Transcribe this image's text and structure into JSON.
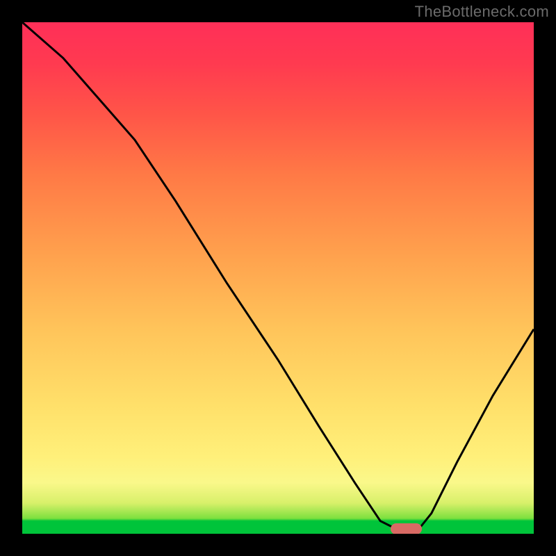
{
  "watermark": "TheBottleneck.com",
  "colors": {
    "background": "#000000",
    "curve": "#000000",
    "marker": "#d86a64",
    "gradient_top": "#ff2f58",
    "gradient_bottom": "#00c43a"
  },
  "chart_data": {
    "type": "line",
    "title": "",
    "xlabel": "",
    "ylabel": "",
    "xlim": [
      0,
      100
    ],
    "ylim": [
      0,
      100
    ],
    "grid": false,
    "legend": false,
    "series": [
      {
        "name": "bottleneck-curve",
        "x": [
          0,
          8,
          15,
          22,
          30,
          40,
          50,
          58,
          65,
          70,
          73,
          76,
          78,
          80,
          85,
          92,
          100
        ],
        "values": [
          100,
          93,
          85,
          77,
          65,
          49,
          34,
          21,
          10,
          2.5,
          1,
          1,
          1.5,
          4,
          14,
          27,
          40
        ]
      }
    ],
    "annotations": [
      {
        "name": "optimal-marker",
        "x": 75,
        "y": 1
      }
    ],
    "band": {
      "description": "vertical performance gradient green(bottom)=good → red(top)=bad",
      "stops": [
        {
          "pos": 0,
          "color": "#00c43a"
        },
        {
          "pos": 2.5,
          "color": "#00c43a"
        },
        {
          "pos": 10,
          "color": "#faf88a"
        },
        {
          "pos": 40,
          "color": "#ffc45a"
        },
        {
          "pos": 70,
          "color": "#ff7a46"
        },
        {
          "pos": 100,
          "color": "#ff2f58"
        }
      ]
    }
  }
}
